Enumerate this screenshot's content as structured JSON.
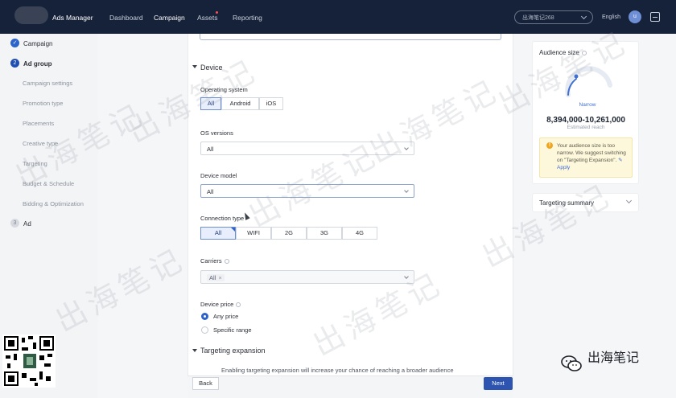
{
  "topbar": {
    "brand": "Ads Manager",
    "nav": [
      "Dashboard",
      "Campaign",
      "Assets",
      "Reporting"
    ],
    "account_select": "出海笔记268",
    "language": "English",
    "avatar_letter": "u"
  },
  "sidebar": {
    "campaign": "Campaign",
    "ad_group": "Ad group",
    "ad_group_step": "2",
    "sub_items": [
      "Campaign settings",
      "Promotion type",
      "Placements",
      "Creative type",
      "Targeting",
      "Budget & Schedule",
      "Bidding & Optimization"
    ],
    "ad": "Ad",
    "ad_step": "3"
  },
  "form": {
    "device_section": "Device",
    "os_label": "Operating system",
    "os_options": [
      "All",
      "Android",
      "iOS"
    ],
    "os_versions_label": "OS versions",
    "os_versions_value": "All",
    "device_model_label": "Device model",
    "device_model_value": "All",
    "connection_label": "Connection type",
    "connection_options": [
      "All",
      "WIFI",
      "2G",
      "3G",
      "4G"
    ],
    "carriers_label": "Carriers",
    "carriers_tag": "All",
    "device_price_label": "Device price",
    "price_any": "Any price",
    "price_specific": "Specific range",
    "targeting_expansion": "Targeting expansion",
    "expansion_text": "Enabling targeting expansion will increase your chance of reaching a broader audience",
    "back": "Back",
    "next": "Next"
  },
  "audience": {
    "title": "Audience size",
    "gauge_label": "Narrow",
    "gauge_level": 0.35,
    "reach": "8,394,000-10,261,000",
    "reach_sub": "Estimated reach",
    "warning_1": "Your audience size is too narrow. We suggest switching on \"Targeting Expansion\". ",
    "warning_link": "Apply",
    "targeting_summary": "Targeting summary"
  },
  "watermark": {
    "text": "出海笔记",
    "brand": "出海笔记"
  },
  "colors": {
    "nav_bg": "#16223a",
    "primary": "#2c54b0",
    "selected_bg": "#e8eefb",
    "warning_bg": "#fdf7dc"
  }
}
